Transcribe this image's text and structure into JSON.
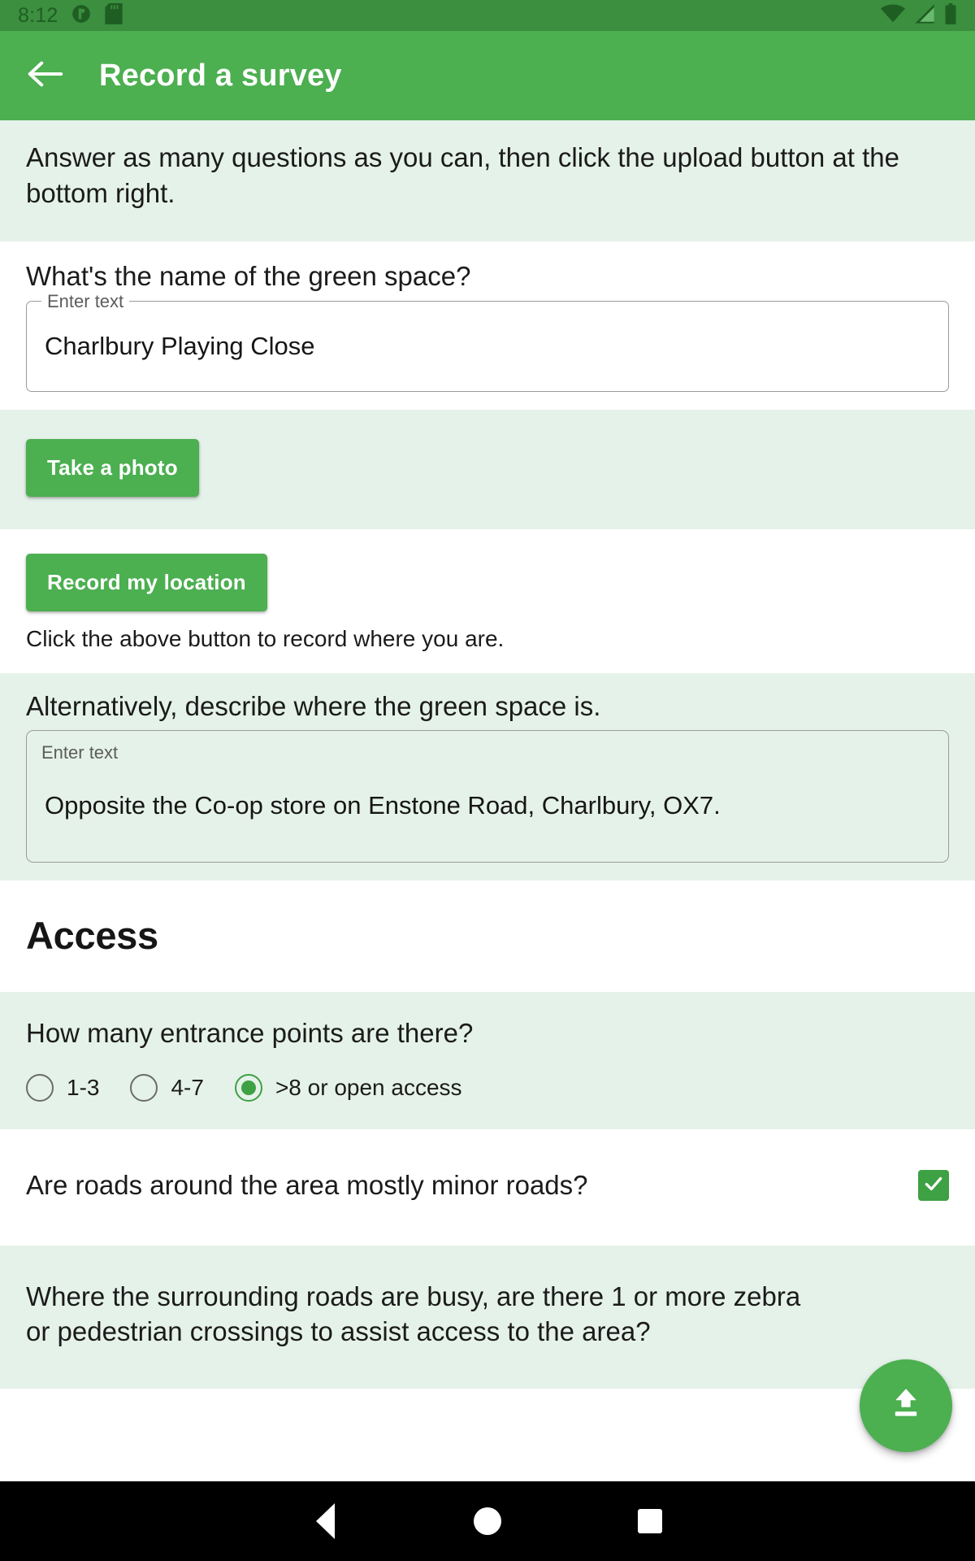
{
  "status_bar": {
    "time": "8:12",
    "icons_left": [
      "app-notification-icon",
      "sd-card-icon"
    ],
    "icons_right": [
      "wifi-icon",
      "cellular-signal-icon",
      "battery-icon"
    ],
    "background_color": "#3b8f3f"
  },
  "app_bar": {
    "back_icon": "back-arrow-icon",
    "title": "Record a survey",
    "background_color": "#4caf50",
    "text_color": "#ffffff"
  },
  "sections": {
    "intro": {
      "text": "Answer as many questions as you can, then click the upload button at the bottom right."
    },
    "name_question": {
      "label": "What's the name of the green space?",
      "field_legend": "Enter text",
      "field_value": "Charlbury Playing Close"
    },
    "photo": {
      "button_label": "Take a photo"
    },
    "location": {
      "button_label": "Record my location",
      "hint": "Click the above button to record where you are."
    },
    "describe_location": {
      "label": "Alternatively, describe where the green space is.",
      "field_legend": "Enter text",
      "field_value": "Opposite the Co-op store on Enstone Road, Charlbury, OX7."
    },
    "access_heading": {
      "title": "Access"
    },
    "entrance_points": {
      "label": "How many entrance points are there?",
      "options": [
        {
          "label": "1-3",
          "selected": false
        },
        {
          "label": "4-7",
          "selected": false
        },
        {
          "label": ">8 or open access",
          "selected": true
        }
      ]
    },
    "minor_roads": {
      "label": "Are roads around the area mostly minor roads?",
      "checked": true
    },
    "crossings": {
      "label": "Where the surrounding roads are busy, are there 1 or more zebra or pedestrian crossings to assist access to the area?"
    }
  },
  "fab": {
    "icon": "upload-icon",
    "color": "#4caf50"
  },
  "nav_bar": {
    "back": "back-triangle-icon",
    "home": "home-circle-icon",
    "recents": "recents-square-icon",
    "background_color": "#000000"
  },
  "theme": {
    "accent": "#4caf50",
    "alt_row_bg": "#e5f2e9",
    "plain_row_bg": "#ffffff",
    "selected_radio": "#3ea144"
  }
}
